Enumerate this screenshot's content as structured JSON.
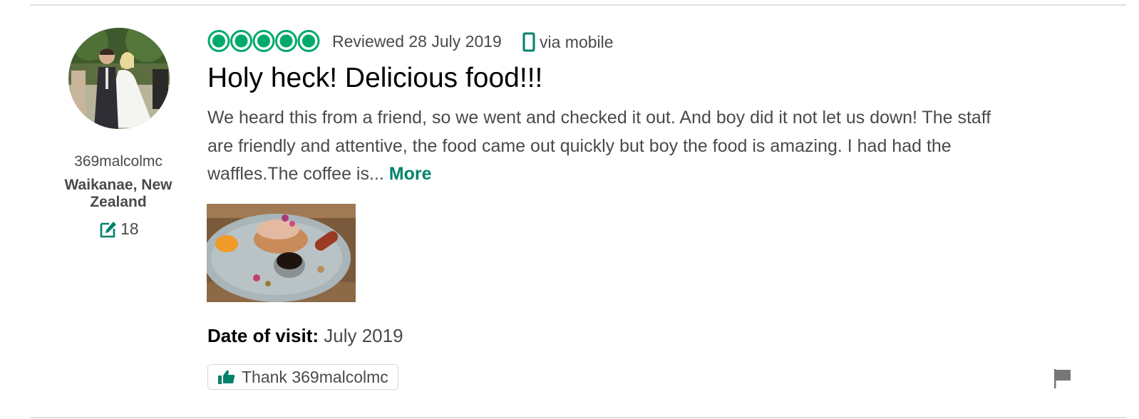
{
  "reviewer": {
    "username": "369malcolmc",
    "location": "Waikanae, New Zealand",
    "contribution_count": "18",
    "avatar_icon": "avatar-photo-wedding-couple"
  },
  "review": {
    "rating": 5,
    "rating_max": 5,
    "rating_color": "#00aa6c",
    "date_text": "Reviewed 28 July 2019",
    "via_text": "via mobile",
    "title": "Holy heck! Delicious food!!!",
    "body": "We heard this from a friend, so we went and checked it out. And boy did it not let us down! The staff are friendly and attentive, the food came out quickly but boy the food is amazing. I had had the waffles.The coffee is...",
    "more_label": "More",
    "photo_icon": "food-photo-waffles-plate",
    "date_of_visit_label": "Date of visit:",
    "date_of_visit_value": "July 2019"
  },
  "actions": {
    "thank_label": "Thank 369malcolmc",
    "thank_icon": "thumbs-up-icon",
    "report_icon": "flag-icon"
  },
  "colors": {
    "accent": "#00826a",
    "rating": "#00aa6c"
  }
}
